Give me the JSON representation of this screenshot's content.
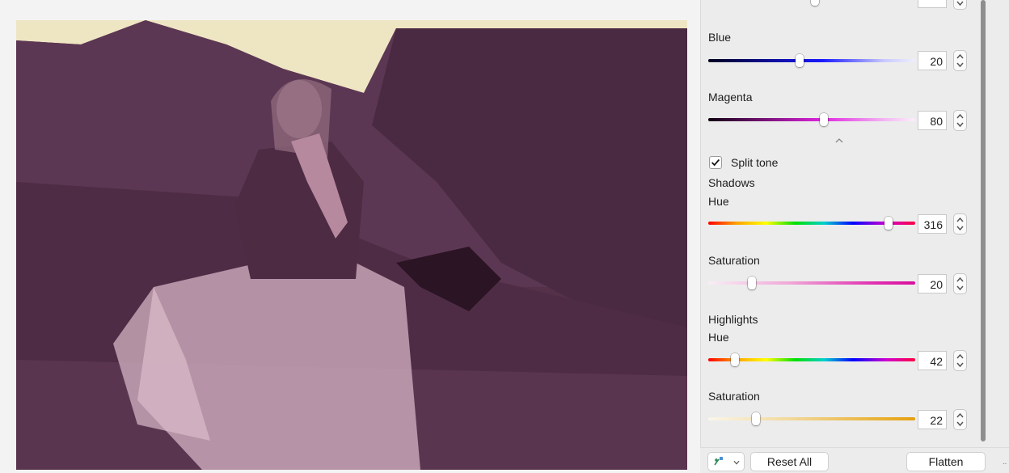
{
  "panel": {
    "blue": {
      "label": "Blue",
      "value": "20",
      "fraction": 0.44
    },
    "magenta": {
      "label": "Magenta",
      "value": "80",
      "fraction": 0.56
    },
    "split_tone": {
      "label": "Split tone",
      "checked": true
    },
    "shadows": {
      "heading": "Shadows",
      "hue": {
        "label": "Hue",
        "value": "316",
        "fraction": 0.87
      },
      "saturation": {
        "label": "Saturation",
        "value": "20",
        "fraction": 0.21
      }
    },
    "highlights": {
      "heading": "Highlights",
      "hue": {
        "label": "Hue",
        "value": "42",
        "fraction": 0.13
      },
      "saturation": {
        "label": "Saturation",
        "value": "22",
        "fraction": 0.23
      }
    }
  },
  "bottom_bar": {
    "reset_label": "Reset All",
    "flatten_label": "Flatten",
    "preset_icon": "magic-adjust-icon"
  },
  "colors": {
    "photo_tint": "#5a3550",
    "sky": "#eee5c3",
    "accent": "#0a63d6"
  }
}
